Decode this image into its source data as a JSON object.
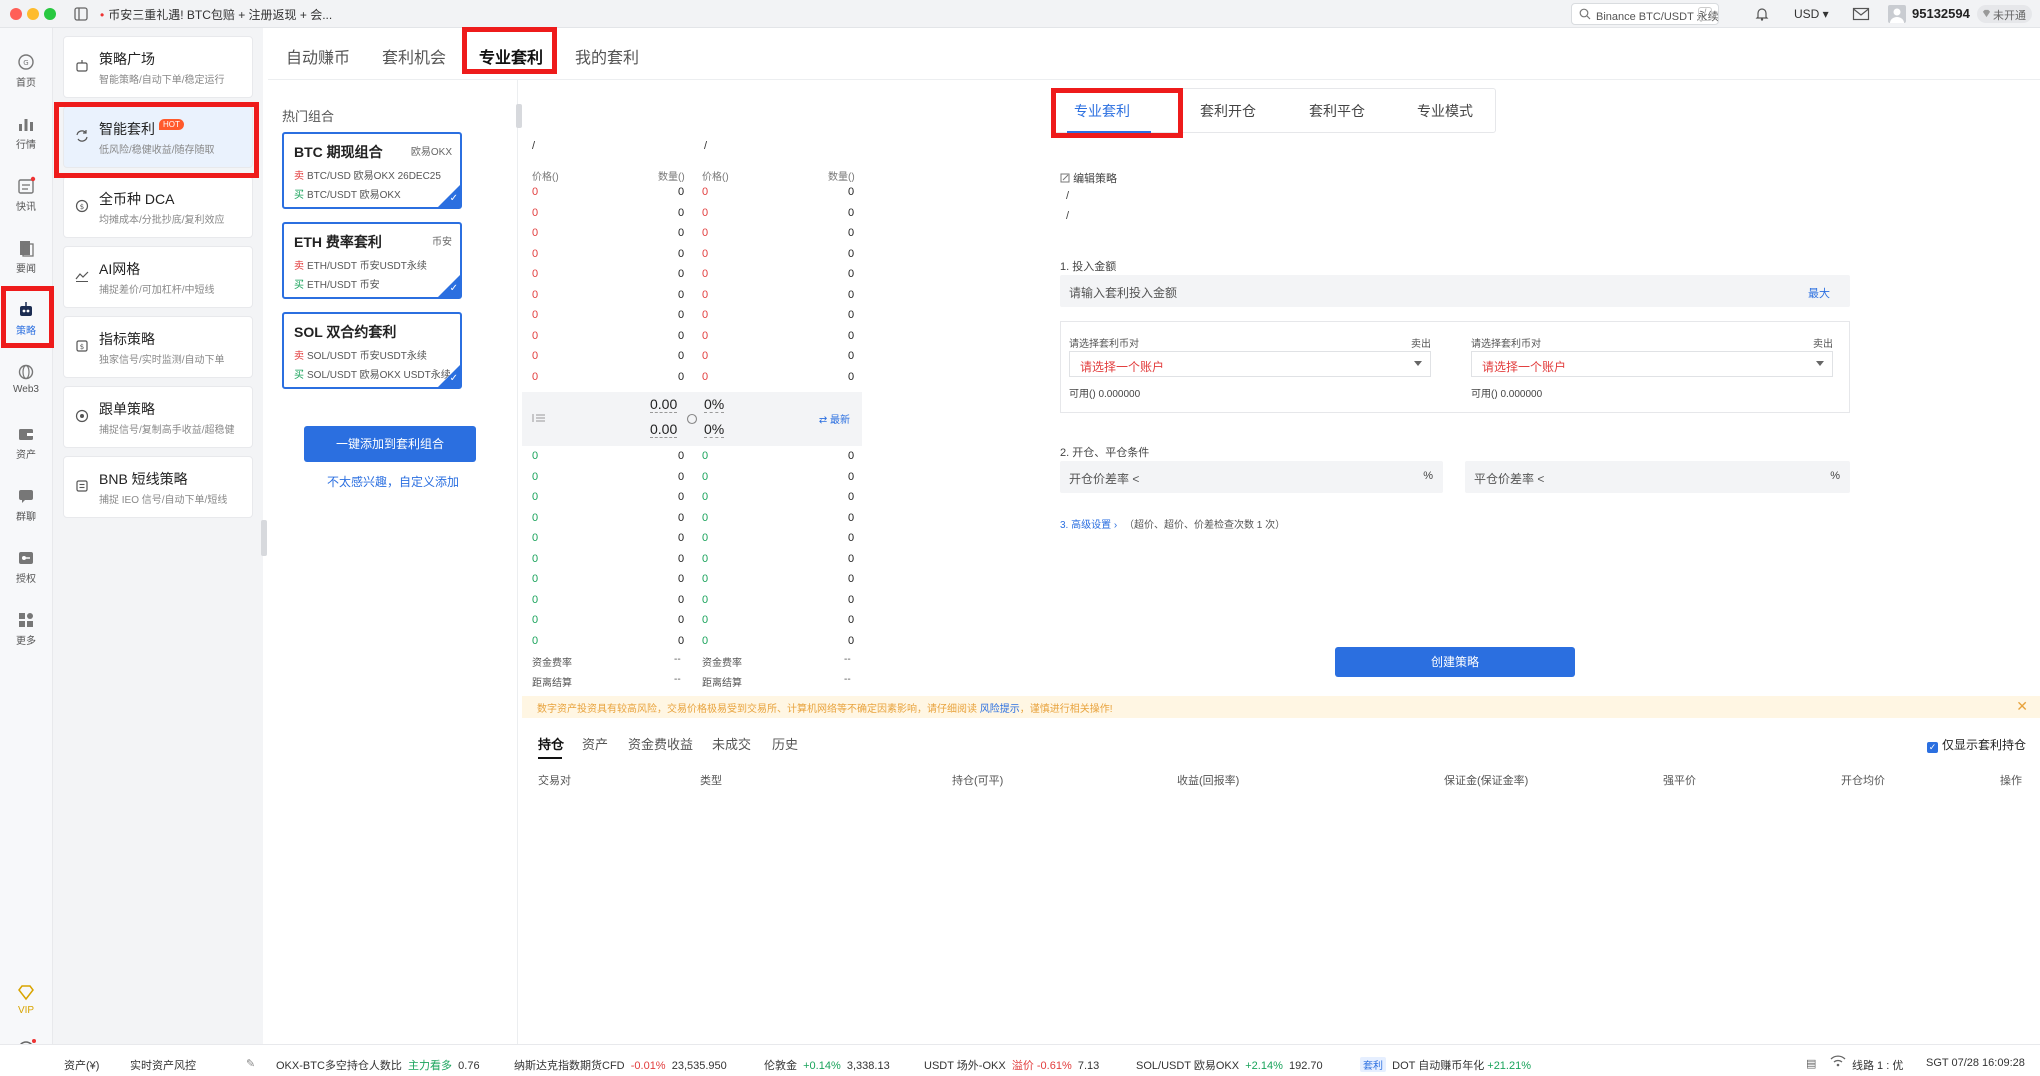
{
  "titlebar": {
    "notice": "币安三重礼遇! BTC包赔 + 注册返现 + 会...",
    "search_placeholder": "Binance BTC/USDT 永续",
    "search_shortcut": "/",
    "currency": "USD",
    "user_id": "95132594",
    "verify_status": "未开通"
  },
  "rail": [
    {
      "label": "首页",
      "icon": "home-icon"
    },
    {
      "label": "行情",
      "icon": "chart-icon"
    },
    {
      "label": "快讯",
      "icon": "news-icon"
    },
    {
      "label": "要闻",
      "icon": "article-icon"
    },
    {
      "label": "策略",
      "icon": "robot-icon"
    },
    {
      "label": "Web3",
      "icon": "web3-icon"
    },
    {
      "label": "资产",
      "icon": "wallet-icon"
    },
    {
      "label": "群聊",
      "icon": "chat-icon"
    },
    {
      "label": "授权",
      "icon": "key-icon"
    },
    {
      "label": "更多",
      "icon": "more-icon"
    },
    {
      "label": "VIP",
      "icon": "vip-icon"
    }
  ],
  "menu": [
    {
      "title": "策略广场",
      "sub": "智能策略/自动下单/稳定运行"
    },
    {
      "title": "智能套利",
      "sub": "低风险/稳健收益/随存随取",
      "badge": "HOT"
    },
    {
      "title": "全币种 DCA",
      "sub": "均摊成本/分批抄底/复利效应"
    },
    {
      "title": "AI网格",
      "sub": "捕捉差价/可加杠杆/中短线"
    },
    {
      "title": "指标策略",
      "sub": "独家信号/实时监测/自动下单"
    },
    {
      "title": "跟单策略",
      "sub": "捕捉信号/复制高手收益/超稳健"
    },
    {
      "title": "BNB 短线策略",
      "sub": "捕捉 IEO 信号/自动下单/短线"
    }
  ],
  "top_tabs": [
    "自动赚币",
    "套利机会",
    "专业套利",
    "我的套利"
  ],
  "hot": {
    "title": "热门组合",
    "combos": [
      {
        "name": "BTC 期现组合",
        "exchange": "欧易OKX",
        "sell_label": "卖",
        "sell": "BTC/USD 欧易OKX 26DEC25",
        "buy_label": "买",
        "buy": "BTC/USDT 欧易OKX"
      },
      {
        "name": "ETH 费率套利",
        "exchange": "币安",
        "sell_label": "卖",
        "sell": "ETH/USDT 币安USDT永续",
        "buy_label": "买",
        "buy": "ETH/USDT 币安"
      },
      {
        "name": "SOL 双合约套利",
        "exchange": "",
        "sell_label": "卖",
        "sell": "SOL/USDT 币安USDT永续",
        "buy_label": "买",
        "buy": "SOL/USDT 欧易OKX USDT永续"
      }
    ],
    "add_button": "一键添加到套利组合",
    "custom_link": "不太感兴趣，自定义添加"
  },
  "book": {
    "left_header": "/",
    "right_header": "/",
    "col_price": "价格()",
    "col_qty": "数量()",
    "price_val": "0",
    "qty_val": "0",
    "mid_value_1": "0.00",
    "mid_value_2": "0.00",
    "mid_pct_1": "0%",
    "mid_pct_2": "0%",
    "latest": "最新",
    "funding_label": "资金费率",
    "funding_val": "--",
    "settle_label": "距离结算",
    "settle_val": "--"
  },
  "sub_tabs": [
    "专业套利",
    "套利开仓",
    "套利平仓",
    "专业模式"
  ],
  "form": {
    "edit_strategy": "编辑策略",
    "slash1": "/",
    "slash2": "/",
    "amount_label": "1. 投入金额",
    "amount_placeholder": "请输入套利投入金额",
    "max": "最大",
    "pair_label": "请选择套利币对",
    "sell_label": "卖出",
    "account_placeholder": "请选择一个账户",
    "available": "可用() 0.000000",
    "cond_label": "2. 开仓、平仓条件",
    "open_placeholder": "开仓价差率 <",
    "close_placeholder": "平仓价差率 <",
    "pct": "%",
    "advanced": "3. 高级设置",
    "advanced_desc": "（超价、超价、价差检查次数 1 次）",
    "create_button": "创建策略"
  },
  "risk": {
    "text_before": "数字资产投资具有较高风险，交易价格极易受到交易所、计算机网络等不确定因素影响，请仔细阅读",
    "link": "风险提示",
    "text_after": "，谨慎进行相关操作!"
  },
  "bottom_tabs": [
    "持仓",
    "资产",
    "资金费收益",
    "未成交",
    "历史"
  ],
  "only_arb": "仅显示套利持仓",
  "table_headers": [
    "交易对",
    "类型",
    "持仓(可平)",
    "收益(回报率)",
    "保证金(保证金率)",
    "强平价",
    "开仓均价",
    "操作"
  ],
  "statusbar": {
    "assets": "资产(¥)",
    "risk_ctrl": "实时资产风控",
    "t1": "OKX-BTC多空持仓人数比",
    "t1_tag": "主力看多",
    "t1_val": "0.76",
    "t2": "纳斯达克指数期货CFD",
    "t2_chg": "-0.01%",
    "t2_val": "23,535.950",
    "t3": "伦敦金",
    "t3_chg": "+0.14%",
    "t3_val": "3,338.13",
    "t4": "USDT 场外-OKX",
    "t4_tag": "溢价",
    "t4_chg": "-0.61%",
    "t4_val": "7.13",
    "t5": "SOL/USDT 欧易OKX",
    "t5_chg": "+2.14%",
    "t5_val": "192.70",
    "t6_tag": "套利",
    "t6": "DOT 自动赚币年化",
    "t6_chg": "+21.21%",
    "line": "线路 1 : 优",
    "time": "SGT 07/28 16:09:28"
  }
}
